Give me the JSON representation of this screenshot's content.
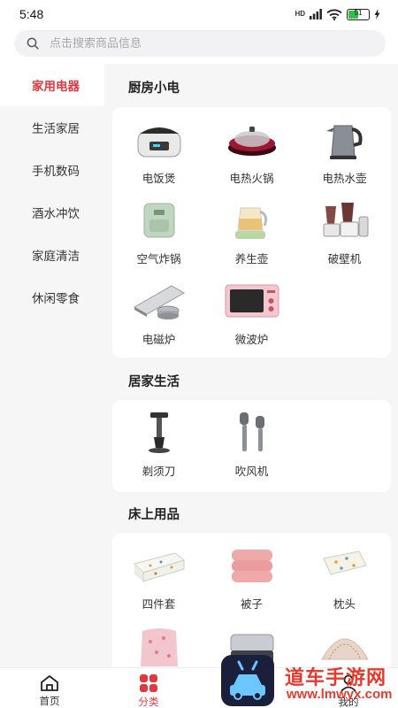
{
  "status": {
    "time": "5:48",
    "battery": "51",
    "network": "HD"
  },
  "search": {
    "placeholder": "点击搜索商品信息"
  },
  "sidebar": {
    "items": [
      {
        "label": "家用电器",
        "active": true
      },
      {
        "label": "生活家居"
      },
      {
        "label": "手机数码"
      },
      {
        "label": "酒水冲饮"
      },
      {
        "label": "家庭清洁"
      },
      {
        "label": "休闲零食"
      }
    ]
  },
  "sections": [
    {
      "title": "厨房小电",
      "items": [
        "电饭煲",
        "电热火锅",
        "电热水壶",
        "空气炸锅",
        "养生壶",
        "破壁机",
        "电磁炉",
        "微波炉"
      ]
    },
    {
      "title": "居家生活",
      "items": [
        "剃须刀",
        "吹风机"
      ]
    },
    {
      "title": "床上用品",
      "items": [
        "四件套",
        "被子",
        "枕头"
      ]
    }
  ],
  "tabbar": {
    "items": [
      {
        "label": "首页",
        "icon": "home-icon"
      },
      {
        "label": "分类",
        "icon": "category-icon",
        "active": true
      },
      {
        "label": "我的",
        "icon": "profile-icon"
      }
    ]
  },
  "watermark": {
    "text": "道车手游网",
    "url": "www.lmwyx.com"
  },
  "colors": {
    "accent": "#e0383e",
    "background": "#f6f6f6"
  }
}
